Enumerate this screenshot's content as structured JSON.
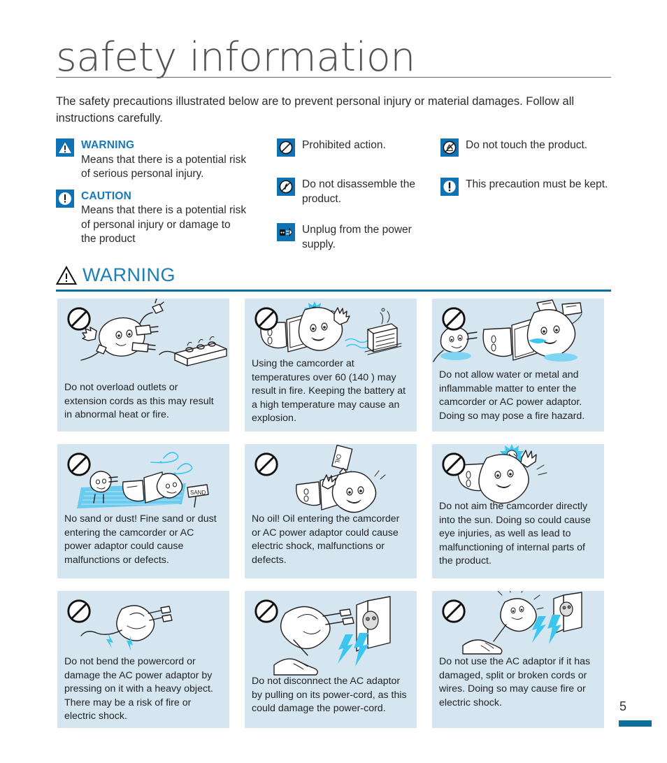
{
  "document": {
    "title": "safety information",
    "intro": "The safety precautions illustrated below are to prevent personal injury or material damages. Follow all instructions carefully.",
    "page_number": "5",
    "accent_color": "#0d6f9c",
    "link_color": "#1878be",
    "card_bg_color": "#d6e6f0"
  },
  "legend": {
    "column1": [
      {
        "icon": "warning-triangle-icon",
        "heading": "WARNING",
        "text": "Means that there is a potential risk of serious personal injury."
      },
      {
        "icon": "caution-exclamation-icon",
        "heading": "CAUTION",
        "text": "Means that there is a potential risk of personal injury or damage to the product"
      }
    ],
    "column2": [
      {
        "icon": "prohibited-icon",
        "heading": "",
        "text": "Prohibited action."
      },
      {
        "icon": "do-not-disassemble-icon",
        "heading": "",
        "text": "Do not disassemble the product."
      },
      {
        "icon": "unplug-icon",
        "heading": "",
        "text": "Unplug from the power supply."
      }
    ],
    "column3": [
      {
        "icon": "do-not-touch-icon",
        "heading": "",
        "text": "Do not touch the product."
      },
      {
        "icon": "must-keep-icon",
        "heading": "",
        "text": "This precaution must be kept."
      }
    ]
  },
  "warning_section": {
    "icon": "warning-triangle-outline-icon",
    "label": "WARNING",
    "cards": [
      {
        "illustration": "overloaded-power-strip",
        "caption": "Do not overload outlets or extension cords as this may result in abnormal heat or fire."
      },
      {
        "illustration": "camcorder-high-temperature-fire",
        "caption": "Using the camcorder at temperatures over 60  (140  ) may result in fire. Keeping the battery at a high temperature may cause an explosion."
      },
      {
        "illustration": "water-entering-camcorder",
        "caption": "Do not allow water or metal and inflammable matter to enter the camcorder or AC power adaptor. Doing so may pose a fire hazard."
      },
      {
        "illustration": "camcorder-in-sand",
        "caption": "No sand or dust! Fine sand or dust entering the camcorder or AC power adaptor could cause malfunctions or defects."
      },
      {
        "illustration": "oil-dripping-on-camcorder",
        "caption": "No oil! Oil entering the camcorder or AC power adaptor could cause electric shock, malfunctions or defects."
      },
      {
        "illustration": "camcorder-aimed-at-sun",
        "caption": "Do not aim the camcorder directly into the sun. Doing so could cause eye injuries, as well as lead to malfunctioning of internal parts of the product."
      },
      {
        "illustration": "bent-powercord-heavy-object",
        "caption": "Do not bend the powercord or damage the AC power adaptor by pressing on it with a heavy object. There may be a risk of fire or electric shock."
      },
      {
        "illustration": "pulling-adaptor-by-cord",
        "caption": "Do not disconnect the AC adaptor by pulling on its power-cord, as this could damage the power-cord."
      },
      {
        "illustration": "damaged-adaptor-cords",
        "caption": "Do not use the AC adaptor if it has damaged, split or broken cords or wires. Doing so may cause fire or electric shock."
      }
    ]
  }
}
